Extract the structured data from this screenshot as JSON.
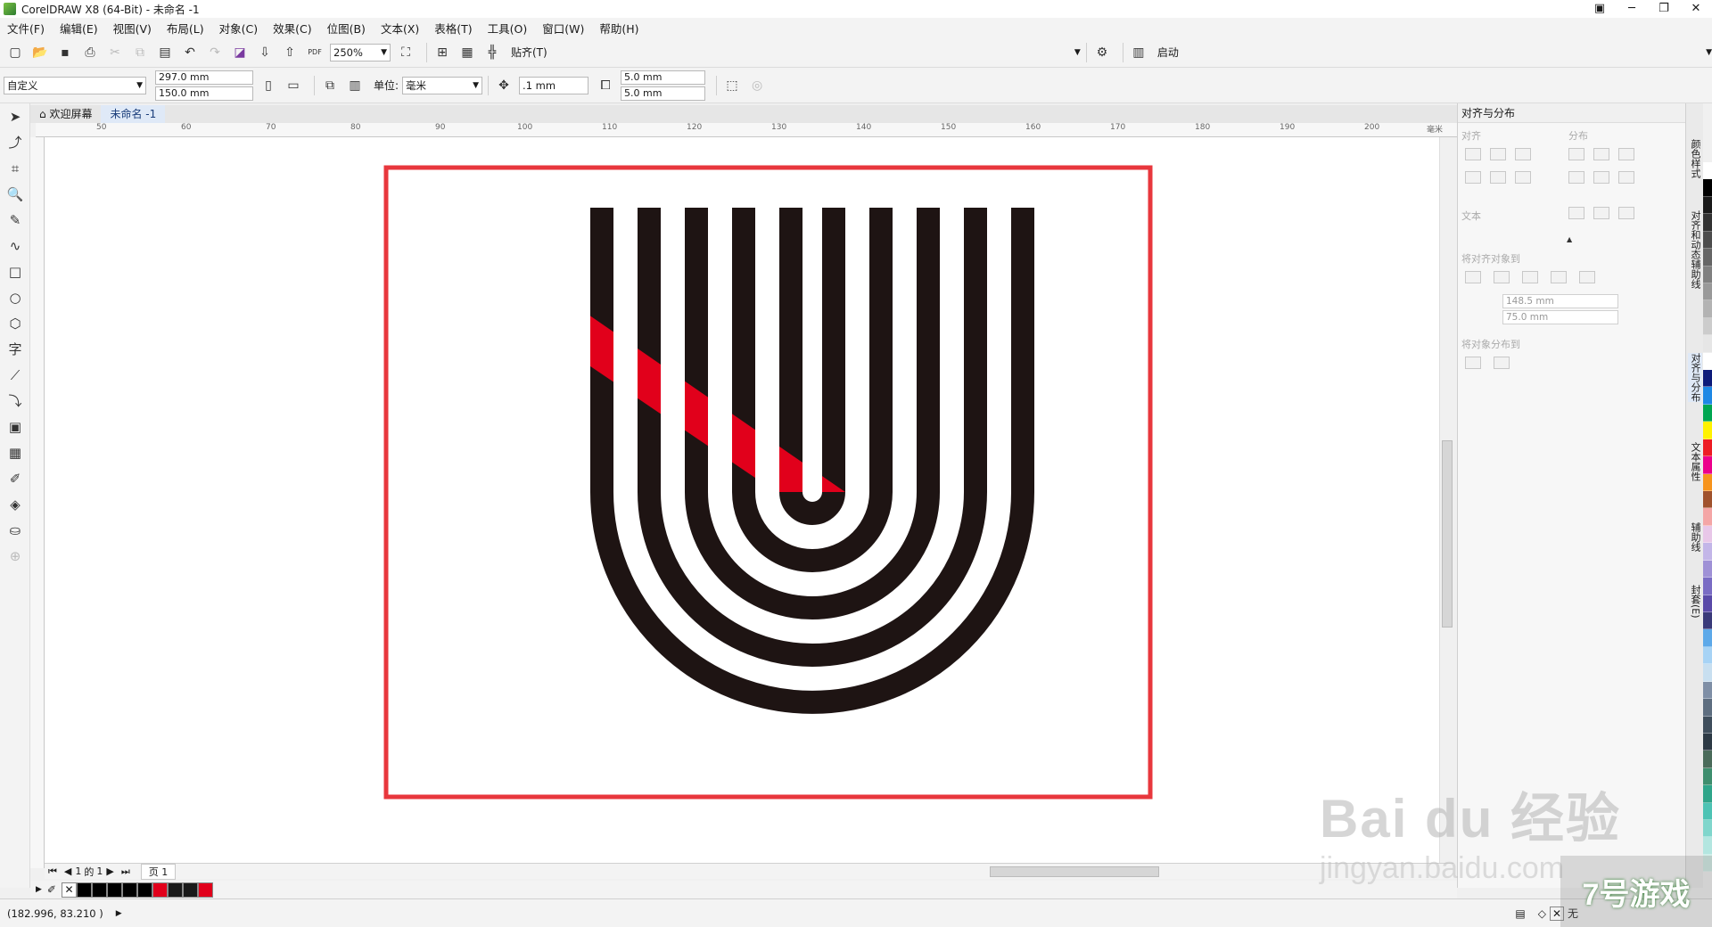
{
  "window": {
    "title": "CorelDRAW X8 (64-Bit) - 未命名 -1"
  },
  "menu": {
    "items": [
      "文件(F)",
      "编辑(E)",
      "视图(V)",
      "布局(L)",
      "对象(C)",
      "效果(C)",
      "位图(B)",
      "文本(X)",
      "表格(T)",
      "工具(O)",
      "窗口(W)",
      "帮助(H)"
    ]
  },
  "toolbar1": {
    "zoom": "250%",
    "snap_label": "贴齐(T)",
    "launch_label": "启动",
    "pdf_label": "PDF"
  },
  "toolbar2": {
    "preset": "自定义",
    "width": "297.0 mm",
    "height": "150.0 mm",
    "units_label": "单位:",
    "units_value": "毫米",
    "nudge": ".1 mm",
    "dup_x": "5.0 mm",
    "dup_y": "5.0 mm"
  },
  "doc_tabs": {
    "welcome": "欢迎屏幕",
    "document": "未命名 -1"
  },
  "ruler_labels": [
    "50",
    "60",
    "70",
    "80",
    "90",
    "100",
    "110",
    "120",
    "130",
    "140",
    "150",
    "160",
    "170",
    "180",
    "190",
    "200"
  ],
  "ruler_unit": "毫米",
  "page_nav": {
    "current": "1",
    "of_label": "的",
    "total": "1",
    "page_tab": "页 1"
  },
  "status": {
    "coords": "(182.996, 83.210 )",
    "fill_none": "无"
  },
  "docker": {
    "title": "对齐与分布",
    "align_label": "对齐",
    "distribute_label": "分布",
    "text_label": "文本",
    "align_objects_to": "将对齐对象到",
    "x_value": "148.5 mm",
    "y_value": "75.0 mm",
    "distribute_objects_to": "将对象分布到"
  },
  "side_tabs": [
    "颜色样式",
    "对齐和动态辅助线",
    "对齐与分布",
    "文本属性",
    "辅助线",
    "封套(E)"
  ],
  "palette_colors": [
    "#ffffff",
    "#000000",
    "#1a1a1a",
    "#333333",
    "#4d4d4d",
    "#666666",
    "#808080",
    "#999999",
    "#b3b3b3",
    "#cccccc",
    "#e6e6e6",
    "#ffffff",
    "#0d1b7a",
    "#1e88e5",
    "#00a651",
    "#fff200",
    "#ed1c24",
    "#ec008c",
    "#f7941d",
    "#a0522d",
    "#f4a6a6",
    "#e8c7e8",
    "#c3b6e8",
    "#9f91d6",
    "#7a6cc4",
    "#5a4aa8",
    "#3a3a7a",
    "#5da9e9",
    "#a7d3f5",
    "#c8dff0",
    "#7f8fa6",
    "#5e6e80",
    "#3f4e5c",
    "#2d3a45",
    "#4a6b5a",
    "#3e8e6e",
    "#2fa58a",
    "#4dc3b4",
    "#80d6cc",
    "#b3e6e0",
    "#d0ece6"
  ],
  "doc_palette": [
    "#000000",
    "#000000",
    "#000000",
    "#000000",
    "#000000",
    "#e1001b",
    "#1a1a1a",
    "#1a1a1a",
    "#e1001b"
  ],
  "artwork": {
    "frame_color": "#e8373d",
    "stripe_color": "#1e1413",
    "accent_color": "#e1001b"
  },
  "watermark": {
    "brand": "Bai du 经验",
    "url": "jingyan.baidu.com",
    "game": "7号游戏"
  }
}
